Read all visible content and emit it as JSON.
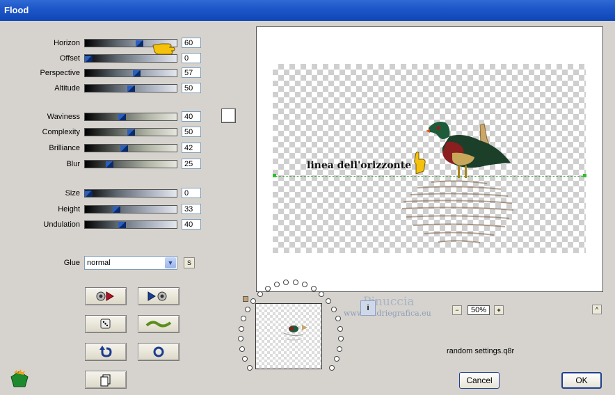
{
  "window": {
    "title": "Flood"
  },
  "params_group1": [
    {
      "label": "Horizon",
      "value": "60",
      "fraction": 0.6
    },
    {
      "label": "Offset",
      "value": "0",
      "fraction": 0.0
    },
    {
      "label": "Perspective",
      "value": "57",
      "fraction": 0.57
    },
    {
      "label": "Altitude",
      "value": "50",
      "fraction": 0.5
    }
  ],
  "params_group2": [
    {
      "label": "Waviness",
      "value": "40",
      "fraction": 0.4
    },
    {
      "label": "Complexity",
      "value": "50",
      "fraction": 0.5
    },
    {
      "label": "Brilliance",
      "value": "42",
      "fraction": 0.42
    },
    {
      "label": "Blur",
      "value": "25",
      "fraction": 0.25
    }
  ],
  "params_group3": [
    {
      "label": "Size",
      "value": "0",
      "fraction": 0.0
    },
    {
      "label": "Height",
      "value": "33",
      "fraction": 0.33
    },
    {
      "label": "Undulation",
      "value": "40",
      "fraction": 0.4
    }
  ],
  "glue": {
    "label": "Glue",
    "value": "normal",
    "s_button": "S"
  },
  "preview": {
    "annotation": "linea dell'orizzonte"
  },
  "watermark": {
    "name": "Pinuccia",
    "site": "www.madriegrafica.eu"
  },
  "zoom": {
    "minus": "−",
    "value": "50%",
    "plus": "+",
    "up": "^"
  },
  "status": {
    "settings_file": "random settings.q8r"
  },
  "buttons": {
    "cancel": "Cancel",
    "ok": "OK"
  },
  "colors": {
    "title_bar": "#0f46b6",
    "dialog_bg": "#d6d3ce",
    "slider_thumb": "#2a5fbf",
    "horizon_line": "#3c9a3c"
  },
  "icons": {
    "randomize_prev": "eye-with-arrow-icon",
    "randomize_next": "arrow-with-eye-icon",
    "randomize": "dice-icon",
    "wave": "wave-icon",
    "undo": "undo-icon",
    "reset": "circle-reset-icon",
    "copy": "copy-icon",
    "logo": "gem-logo-icon",
    "pointer": "hand-pointer-icon"
  }
}
